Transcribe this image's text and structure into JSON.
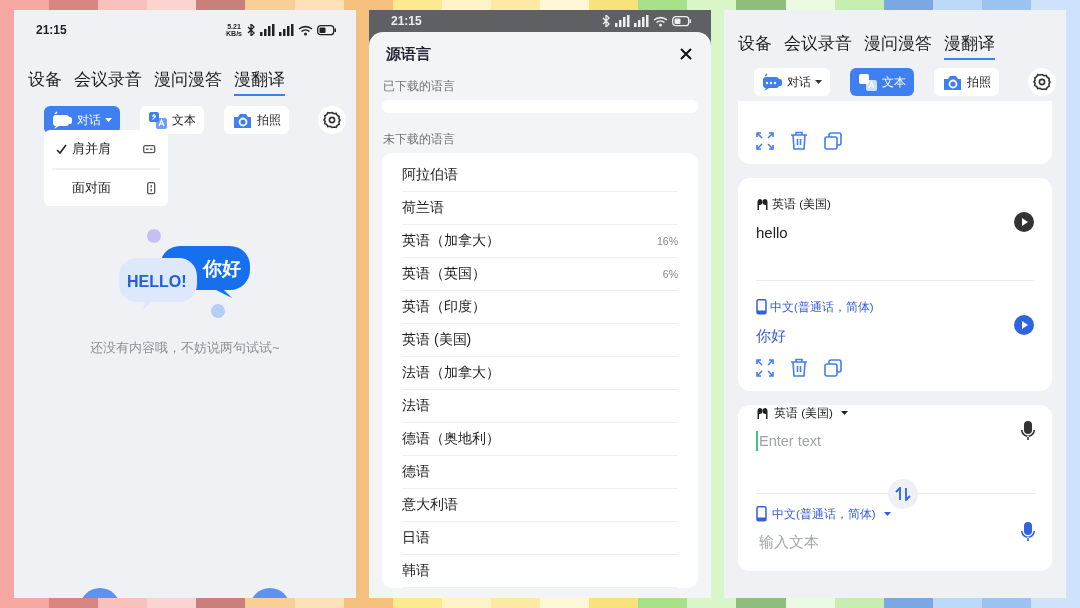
{
  "conversation_screen": {
    "status_bar": {
      "time": "21:15",
      "net_speed": "5.21",
      "net_unit": "KB/s"
    },
    "tabs": [
      {
        "label": "设备",
        "selected": false
      },
      {
        "label": "会议录音",
        "selected": false
      },
      {
        "label": "漫问漫答",
        "selected": false
      },
      {
        "label": "漫翻译",
        "selected": true
      }
    ],
    "modes": [
      {
        "label": "对话",
        "kind": "conversation",
        "selected": true,
        "menu": true
      },
      {
        "label": "文本",
        "kind": "text",
        "selected": false,
        "menu": false
      },
      {
        "label": "拍照",
        "kind": "photo",
        "selected": false,
        "menu": false
      }
    ],
    "layout_menu": [
      {
        "label": "肩并肩",
        "kind": "horizontal",
        "checked": true
      },
      {
        "label": "面对面",
        "kind": "vertical",
        "checked": false
      }
    ],
    "illustration": {
      "text_left": "HELLO!",
      "text_right": "你好"
    },
    "empty_message": "还没有内容哦，不妨说两句试试~"
  },
  "language_sheet": {
    "status_bar": {
      "time": "21:15"
    },
    "title": "源语言",
    "downloaded_label": "已下载的语言",
    "available_label": "未下载的语言",
    "languages": [
      {
        "name": "阿拉伯语"
      },
      {
        "name": "荷兰语"
      },
      {
        "name": "英语（加拿大）",
        "progress": "16%"
      },
      {
        "name": "英语（英国）",
        "progress": "6%"
      },
      {
        "name": "英语（印度）"
      },
      {
        "name": "英语 (美国)"
      },
      {
        "name": "法语（加拿大）"
      },
      {
        "name": "法语"
      },
      {
        "name": "德语（奥地利）"
      },
      {
        "name": "德语"
      },
      {
        "name": "意大利语"
      },
      {
        "name": "日语"
      },
      {
        "name": "韩语"
      }
    ]
  },
  "text_screen": {
    "tabs": [
      {
        "label": "设备",
        "selected": false
      },
      {
        "label": "会议录音",
        "selected": false
      },
      {
        "label": "漫问漫答",
        "selected": false
      },
      {
        "label": "漫翻译",
        "selected": true
      }
    ],
    "modes": [
      {
        "label": "对话",
        "kind": "conversation",
        "selected": false,
        "menu": true
      },
      {
        "label": "文本",
        "kind": "text",
        "selected": true,
        "menu": false
      },
      {
        "label": "拍照",
        "kind": "photo",
        "selected": false,
        "menu": false
      }
    ],
    "cards": [
      {
        "clipped": true
      },
      {
        "clipped": false,
        "entries": [
          {
            "kind": "source",
            "language": "英语 (美国)",
            "text": "hello"
          },
          {
            "kind": "target",
            "language": "中文(普通话，简体)",
            "text": "你好"
          }
        ]
      }
    ],
    "input": [
      {
        "kind": "source",
        "language": "英语 (美国)",
        "placeholder": "Enter text",
        "focused": true
      },
      {
        "kind": "target",
        "language": "中文(普通话，简体)",
        "placeholder": "输入文本",
        "focused": false
      }
    ]
  }
}
